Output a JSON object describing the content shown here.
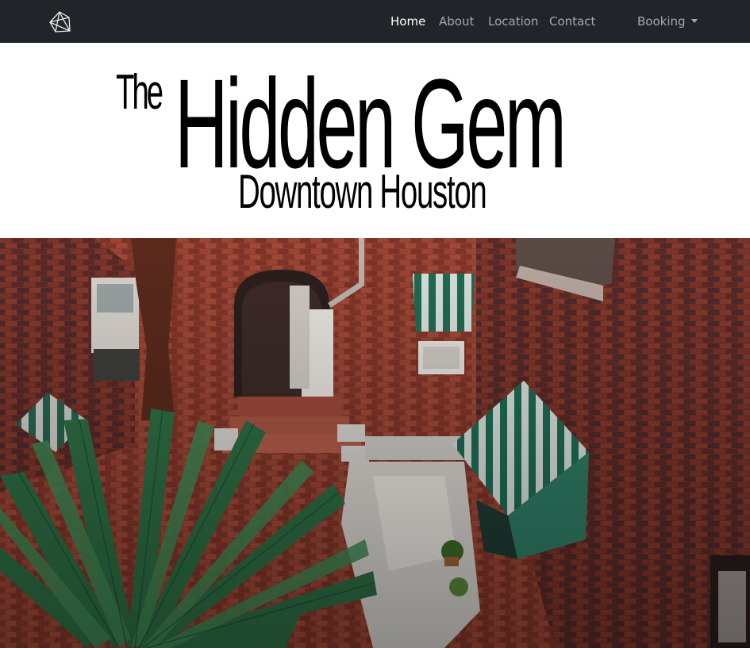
{
  "navbar": {
    "logo_icon": "diamond-gem-icon",
    "links": [
      {
        "label": "Home",
        "active": true
      },
      {
        "label": "About",
        "active": false
      },
      {
        "label": "Location",
        "active": false
      },
      {
        "label": "Contact",
        "active": false
      }
    ],
    "booking": {
      "label": "Booking",
      "icon": "caret-down-icon"
    }
  },
  "hero": {
    "the": "The",
    "title": "Hidden Gem",
    "subtitle": "Downtown Houston"
  },
  "colors": {
    "navbar_bg": "#212529",
    "nav_inactive": "#a6a8ab",
    "nav_active": "#ffffff",
    "brick": "#8a3a2c",
    "awning_green": "#1f6b55"
  }
}
